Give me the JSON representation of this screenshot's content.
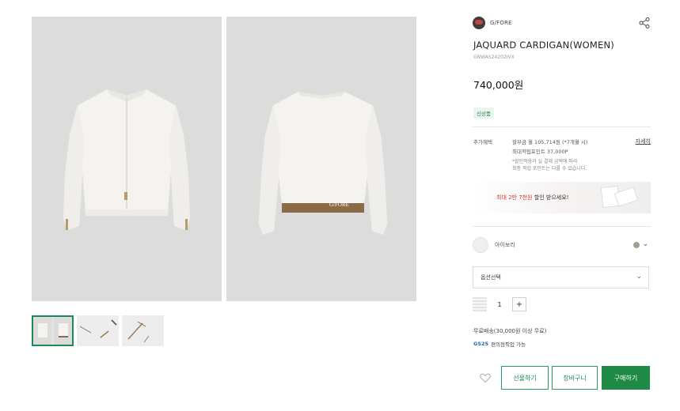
{
  "gallery": {
    "front_photo_icon": "cardigan-front",
    "back_photo_icon": "cardigan-back",
    "back_print": "G/FORE",
    "thumbnails": [
      {
        "icon": "thumb-cardigan-front-back",
        "selected": true
      },
      {
        "icon": "thumb-detail-zipper",
        "selected": false
      },
      {
        "icon": "thumb-detail-tag",
        "selected": false
      }
    ]
  },
  "product": {
    "brand": "G/FORE",
    "title": "JAQUARD CARDIGAN(WOMEN)",
    "code": "GNWAS24202IVX",
    "price": "740,000원",
    "badge": "신상품"
  },
  "benefits": {
    "label": "추가혜택",
    "line1": "할부금 월 105,714원 (*7개월 시)",
    "line2": "최대적립포인트 37,000P",
    "note1": "*할인적용과 실 결제 금액에 따라",
    "note2": "최종 적립 포인트는 다를 수 있습니다.",
    "detail_link": "자세히"
  },
  "promo": {
    "highlight": "최대 2만 7천원",
    "text": " 할인 받으세요!"
  },
  "color": {
    "name": "아이보리",
    "swatch": "#a59f92"
  },
  "option": {
    "label": "옵션선택"
  },
  "quantity": {
    "value": "1",
    "plus": "+"
  },
  "shipping": {
    "text": "무료배송(30,000원 이상 무료)",
    "gs_logo": "GS25",
    "pickup": "편의점픽업 가능"
  },
  "actions": {
    "gift": "선물하기",
    "cart": "장바구니",
    "buy": "구매하기"
  },
  "colors": {
    "accent": "#1e8a55",
    "background": "#ffffff",
    "photo_bg": "#dcdcdc",
    "promo_highlight": "#d23b35"
  }
}
